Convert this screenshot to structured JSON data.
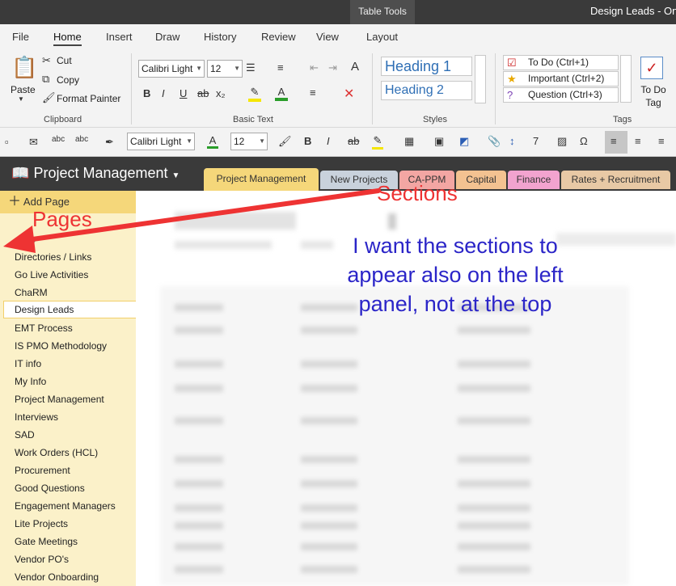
{
  "titlebar": {
    "context_tab": "Table Tools",
    "title": "Design Leads  -  One"
  },
  "menu_tabs": [
    "File",
    "Home",
    "Insert",
    "Draw",
    "History",
    "Review",
    "View",
    "Layout"
  ],
  "clipboard": {
    "paste": "Paste",
    "cut": "Cut",
    "copy": "Copy",
    "format_painter": "Format Painter",
    "label": "Clipboard"
  },
  "basic_text": {
    "font": "Calibri Light",
    "size": "12",
    "label": "Basic Text"
  },
  "styles": {
    "heading1": "Heading 1",
    "heading2": "Heading 2",
    "label": "Styles"
  },
  "tags": {
    "items": [
      "To Do (Ctrl+1)",
      "Important (Ctrl+2)",
      "Question (Ctrl+3)"
    ],
    "todo_tag": "To Do Tag",
    "label": "Tags"
  },
  "quickbar": {
    "font": "Calibri Light",
    "size": "12"
  },
  "notebook": {
    "name": "Project Management"
  },
  "sections": [
    "Project Management",
    "New Projects",
    "CA-PPM",
    "Capital",
    "Finance",
    "Rates + Recruitment"
  ],
  "add_page": "Add Page",
  "pages": [
    "Directories / Links",
    "Go Live Activities",
    "ChaRM",
    "Design Leads",
    "EMT Process",
    "IS PMO Methodology",
    "IT info",
    "My Info",
    "Project Management",
    "Interviews",
    "SAD",
    "Work Orders (HCL)",
    "Procurement",
    "Good Questions",
    "Engagement Managers",
    "Lite Projects",
    "Gate Meetings",
    "Vendor PO's",
    "Vendor Onboarding"
  ],
  "partial_page": "eads",
  "annotations": {
    "sections": "Sections",
    "pages": "Pages",
    "note": "I want the sections to appear also on the left panel, not at the top"
  },
  "colors": {
    "accent_red": "#ee3333",
    "note_blue": "#2b25c8",
    "page_panel": "#fbf1c9",
    "add_page_bg": "#f5d77a"
  }
}
